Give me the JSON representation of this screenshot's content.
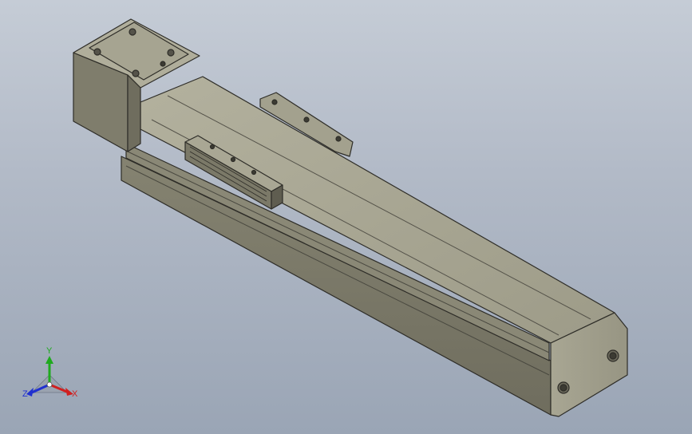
{
  "viewport": {
    "background_top": "#c5ccd6",
    "background_bottom": "#9aa5b5"
  },
  "model": {
    "description_icon": "linear-actuator-3d-model",
    "body_color": "#8f8d7c",
    "edge_color": "#2e2d28"
  },
  "triad": {
    "x_label": "X",
    "y_label": "Y",
    "z_label": "Z",
    "x_color": "#d02020",
    "y_color": "#1faa1f",
    "z_color": "#2030d0"
  }
}
